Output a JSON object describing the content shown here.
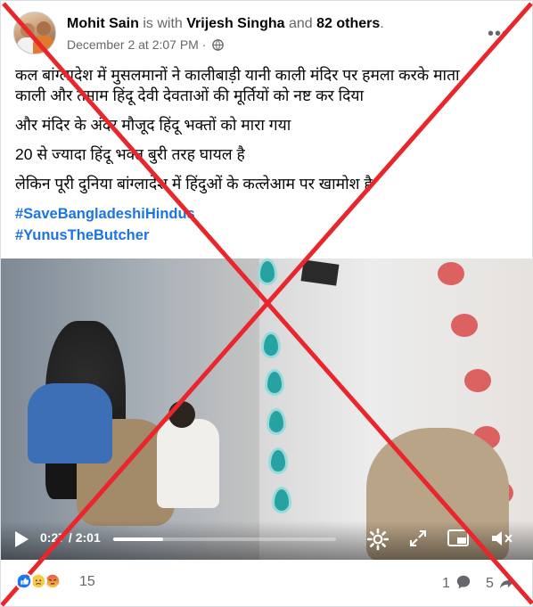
{
  "post": {
    "author": "Mohit Sain",
    "with_text": "is with",
    "tagged": "Vrijesh Singha",
    "and_text": "and",
    "others": "82 others",
    "period": ".",
    "timestamp": "December 2 at 2:07 PM",
    "separator": "·",
    "privacy_icon": "globe-icon",
    "more_icon": "more-options-icon",
    "more_label": "•••"
  },
  "body": {
    "lines": [
      "कल बांग्लादेश में मुसलमानों ने कालीबाड़ी यानी काली मंदिर पर हमला करके माता",
      "काली और तमाम हिंदू देवी देवताओं की मूर्तियों को नष्ट कर दिया",
      "और मंदिर के अंदर मौजूद हिंदू भक्तों को मारा गया",
      " 20 से ज्यादा हिंदू भक्त बुरी तरह घायल है",
      "लेकिन पूरी दुनिया बांग्लादेश में हिंदुओं के कत्लेआम पर खामोश है"
    ],
    "hashtags": [
      "#SaveBangladeshiHindus",
      "#YunusTheButcher"
    ]
  },
  "video": {
    "current_time": "0:27",
    "time_separator": " / ",
    "duration": "2:01",
    "progress_fraction": 0.223,
    "icons": [
      "play-icon",
      "settings-icon",
      "expand-icon",
      "pip-icon",
      "mute-icon"
    ]
  },
  "footer": {
    "reaction_icons": [
      "like-icon",
      "sad-icon",
      "angry-icon"
    ],
    "reaction_count": "15",
    "comment_count": "1",
    "comment_icon": "comment-icon",
    "share_count": "5",
    "share_icon": "share-icon"
  },
  "overlay": {
    "mark": "red-cross",
    "color": "#e8262b"
  },
  "colors": {
    "link": "#1b74e4",
    "secondary_text": "#65676b",
    "cross": "#e8262b"
  }
}
